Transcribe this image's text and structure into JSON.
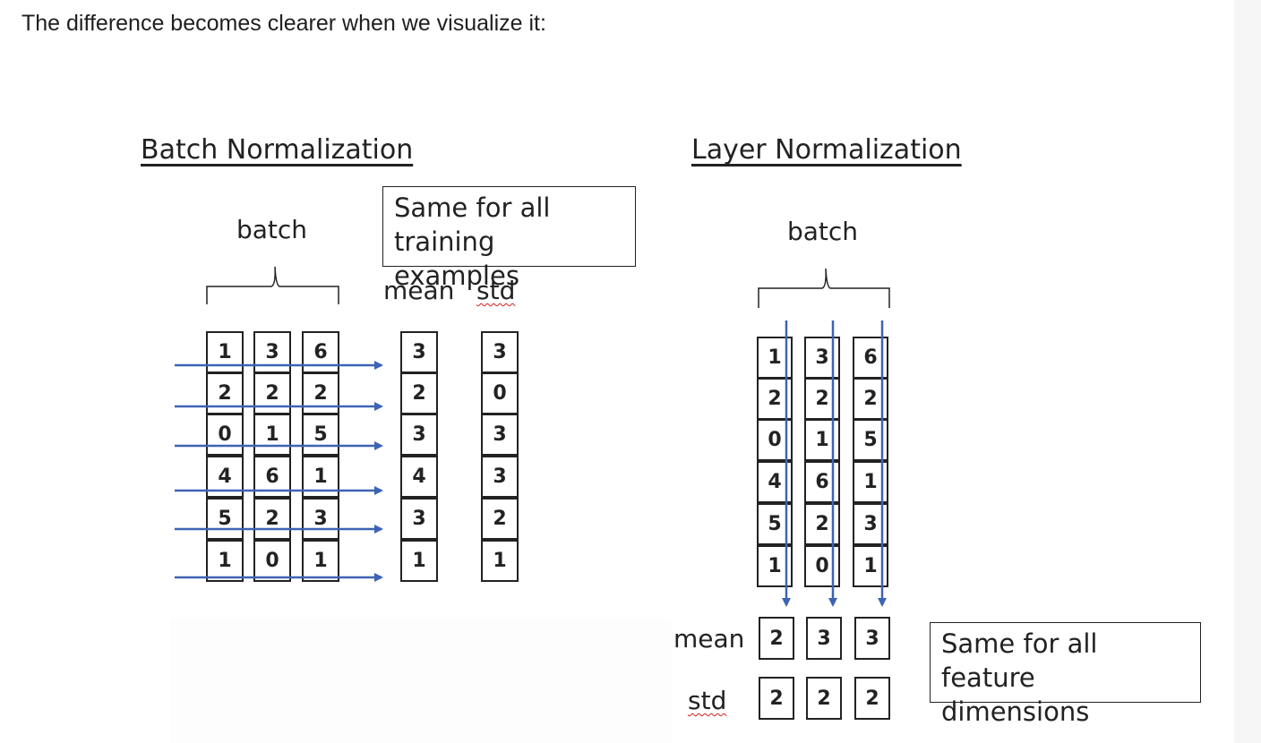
{
  "intro_text": "The difference becomes clearer when we visualize it:",
  "batch_norm": {
    "title": "Batch Normalization",
    "batch_label": "batch",
    "note": [
      "Same for all",
      "training examples"
    ],
    "mean_label": "mean",
    "std_label": "std",
    "columns": [
      [
        1,
        2,
        0,
        4,
        5,
        1
      ],
      [
        3,
        2,
        1,
        6,
        2,
        0
      ],
      [
        6,
        2,
        5,
        1,
        3,
        1
      ]
    ],
    "mean": [
      3,
      2,
      3,
      4,
      3,
      1
    ],
    "std": [
      3,
      0,
      3,
      3,
      2,
      1
    ]
  },
  "layer_norm": {
    "title": "Layer Normalization",
    "batch_label": "batch",
    "note": [
      "Same for all",
      "feature dimensions"
    ],
    "mean_label": "mean",
    "std_label": "std",
    "columns": [
      [
        1,
        2,
        0,
        4,
        5,
        1
      ],
      [
        3,
        2,
        1,
        6,
        2,
        0
      ],
      [
        6,
        2,
        5,
        1,
        3,
        1
      ]
    ],
    "mean": [
      2,
      3,
      3
    ],
    "std": [
      2,
      2,
      2
    ]
  },
  "colors": {
    "arrow": "#3d63b5",
    "border": "#222222"
  }
}
